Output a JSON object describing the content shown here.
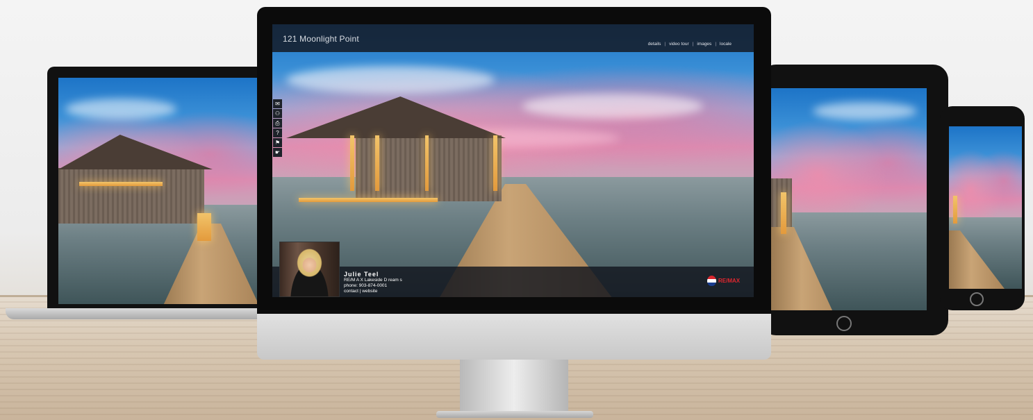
{
  "listing": {
    "title": "121 Moonlight Point",
    "nav": {
      "details": "details",
      "video_tour": "video tour",
      "images": "images",
      "locale": "locale",
      "separator": "|"
    }
  },
  "agent": {
    "name": "Julie Teel",
    "brokerage": "RE/M A X  Lakeside D ream s",
    "phone": "phone: 903-874-0001",
    "contact": "contact",
    "link_separator": " | ",
    "website": "website"
  },
  "brand": {
    "logo_text": "RE/MAX",
    "logo_colors": [
      "#d8262e",
      "#ffffff",
      "#1a3d8f"
    ]
  },
  "toolbar": {
    "icons": [
      "comment-icon",
      "share-icon",
      "print-icon",
      "help-icon",
      "flag-icon",
      "hand-pointer-icon"
    ],
    "glyphs": [
      "✉",
      "⚇",
      "⎙",
      "?",
      "⚑",
      "☛"
    ]
  },
  "colors": {
    "header_bg": "#141a24",
    "accent_red": "#e0262e"
  }
}
